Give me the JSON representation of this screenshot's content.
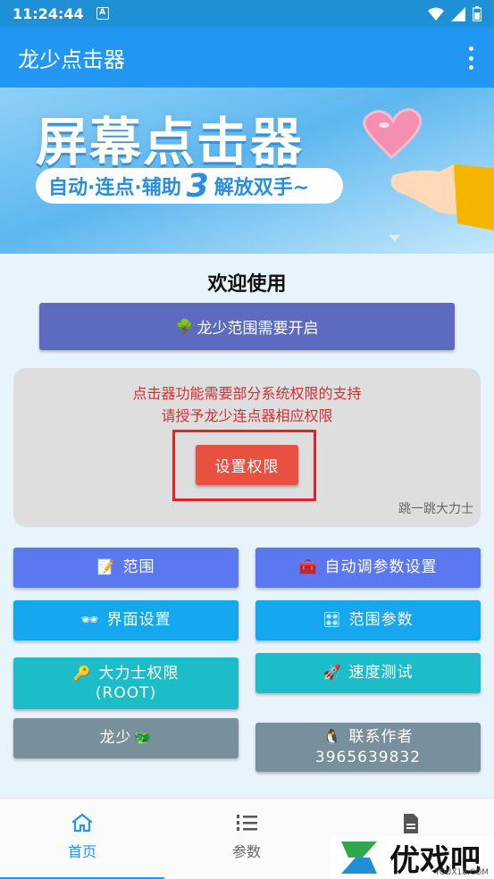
{
  "status": {
    "time": "11:24:44",
    "badge": "A"
  },
  "app": {
    "title": "龙少点击器"
  },
  "banner": {
    "title": "屏幕点击器",
    "subtitle_left": "自动·连点·辅助",
    "subtitle_num": "3",
    "subtitle_right": "解放双手~"
  },
  "welcome": "欢迎使用",
  "range_button": {
    "icon": "🌳",
    "label": "龙少范围需要开启"
  },
  "permission_card": {
    "line1": "点击器功能需要部分系统权限的支持",
    "line2": "请授予龙少连点器相应权限",
    "button_label": "设置权限",
    "signature": "跳一跳大力士"
  },
  "buttons": {
    "range": {
      "icon": "📝",
      "label": "范围"
    },
    "auto_params": {
      "icon": "🧰",
      "label": "自动调参数设置"
    },
    "ui_settings": {
      "icon": "🕶",
      "label": "界面设置"
    },
    "range_params": {
      "icon": "🎛",
      "label": "范围参数"
    },
    "root": {
      "icon": "🔑",
      "label": "大力士权限",
      "sub": "(ROOT)"
    },
    "speed_test": {
      "icon": "🚀",
      "label": "速度测试"
    },
    "longshao": {
      "label": "龙少",
      "icon": "🐲"
    },
    "contact": {
      "icon": "🐧",
      "label": "联系作者",
      "sub": "3965639832"
    }
  },
  "nav": {
    "home": "首页",
    "params": "参数"
  },
  "watermark": {
    "text": "优戏吧",
    "url": "YOUX18.COM"
  },
  "colors": {
    "primary": "#2196f3",
    "indigo": "#5c6bc0",
    "danger": "#e8503f"
  }
}
